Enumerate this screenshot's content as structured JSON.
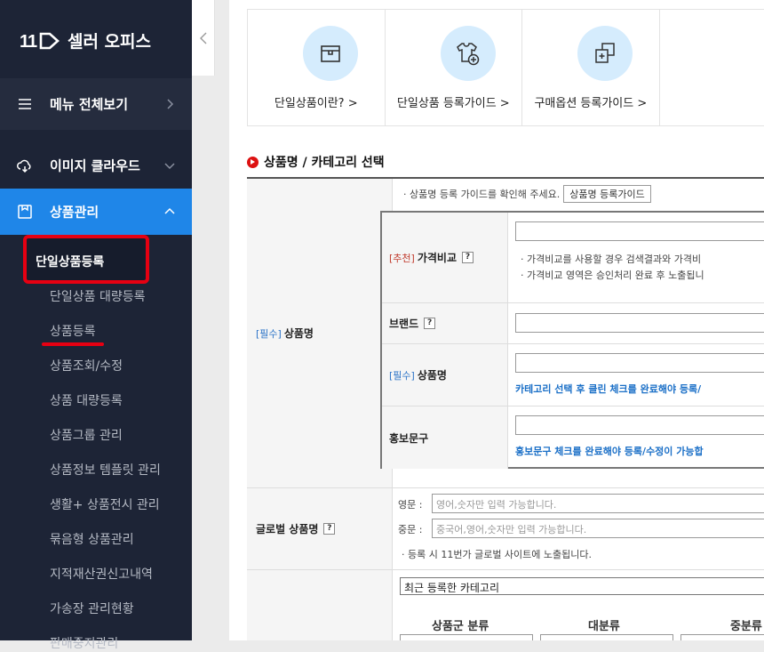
{
  "sidebar": {
    "logo_text": "셀러 오피스",
    "menu_all": "메뉴 전체보기",
    "cloud": "이미지 클라우드",
    "product_mgmt": "상품관리",
    "items": [
      "단일상품등록",
      "단일상품 대량등록",
      "상품등록",
      "상품조회/수정",
      "상품 대량등록",
      "상품그룹 관리",
      "상품정보 템플릿 관리",
      "생활+ 상품전시 관리",
      "묶음형 상품관리",
      "지적재산권신고내역",
      "가송장 관리현황",
      "판매중지관리"
    ]
  },
  "guides": [
    {
      "label": "단일상품이란? >"
    },
    {
      "label": "단일상품 등록가이드 >"
    },
    {
      "label": "구매옵션 등록가이드 >"
    }
  ],
  "section_title": "상품명 / 카테고리 선택",
  "form": {
    "req": "[필수]",
    "rec": "[추천]",
    "product_name_label": "상품명",
    "guide_note": "· 상품명 등록 가이드를 확인해 주세요.",
    "guide_btn": "상품명 등록가이드",
    "price_compare_label": "가격비교",
    "price_note1": "· 가격비교를 사용할 경우 검색결과와 가격비",
    "price_note2": "· 가격비교 영역은 승인처리 완료 후 노출됩니",
    "brand_label": "브랜드",
    "name_label": "상품명",
    "name_note": "카테고리 선택 후 클린 체크를 완료해야 등록/",
    "promo_label": "홍보문구",
    "promo_note": "홍보문구 체크를 완료해야 등록/수정이 가능합",
    "global_label": "글로벌 상품명",
    "en_label": "영문 :",
    "en_ph": "영어,숫자만 입력 가능합니다.",
    "cn_label": "중문 :",
    "cn_ph": "중국어,영어,숫자만 입력 가능합니다.",
    "global_note": "· 등록 시 11번가 글로벌 사이트에 노출됩니다.",
    "recent_cat": "최근 등록한 카테고리",
    "cat_group": "상품군 분류",
    "cat_large": "대분류",
    "cat_mid": "중분류"
  }
}
